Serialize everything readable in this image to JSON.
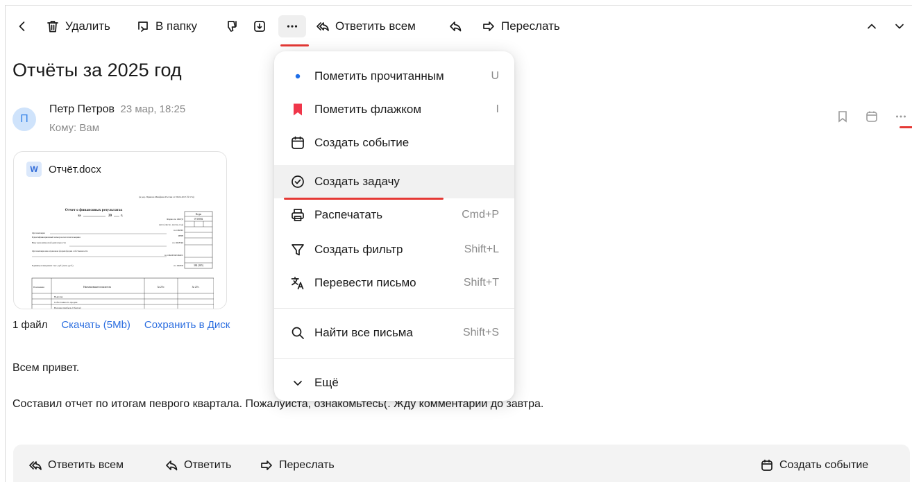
{
  "toolbar": {
    "delete_label": "Удалить",
    "folder_label": "В папку",
    "reply_all_label": "Ответить всем",
    "forward_label": "Переслать"
  },
  "message": {
    "subject": "Отчёты за 2025 год",
    "sender_initial": "П",
    "sender_name": "Петр Петров",
    "date": "23 мар, 18:25",
    "to": "Кому: Вам",
    "body_line1": "Всем привет.",
    "body_line2": "Составил  отчет по итогам певрого квартала. Пожалуйста, ознакомьтесь(. Жду комментарии до завтра."
  },
  "attachment": {
    "badge": "W",
    "filename": "Отчёт.docx",
    "count": "1 файл",
    "download": "Скачать (5Mb)",
    "save_disk": "Сохранить в Диск",
    "preview_title": "Отчет о финансовых результатах",
    "preview_za": "за",
    "preview_year": "20",
    "preview_g": "г.",
    "preview_codes": "Коды",
    "preview_okud": "0710002",
    "preview_code_last": "384 (385)",
    "preview_approval": "(в ред. Приказа Минфина России от 06.04.2015 № 57н)",
    "preview_rows": [
      "Форма по ОКУД",
      "Дата (число, месяц, год)",
      "по ОКПО",
      "ИНН",
      "по ОКВЭД",
      "по ОКОПФ/ОКФС",
      "по ОКЕИ"
    ],
    "preview_left": [
      "Организация",
      "Идентификационный номер налогоплательщика",
      "Вид экономической деятельности",
      "Организационно-правовая форма/форма собственности",
      "Единица измерения: тыс. руб. (млн. руб.)"
    ],
    "preview_table_head": [
      "Пояснения",
      "Наименование показателя",
      "За 20 г.",
      "За 20 г."
    ],
    "preview_table_rows": [
      "Выручка",
      "Себестоимость продаж",
      "Валовая прибыль (убыток)"
    ]
  },
  "menu": {
    "items": [
      {
        "label": "Пометить прочитанным",
        "shortcut": "U"
      },
      {
        "label": "Пометить флажком",
        "shortcut": "I"
      },
      {
        "label": "Создать событие",
        "shortcut": ""
      },
      {
        "label": "Создать задачу",
        "shortcut": ""
      },
      {
        "label": "Распечатать",
        "shortcut": "Cmd+P"
      },
      {
        "label": "Создать фильтр",
        "shortcut": "Shift+L"
      },
      {
        "label": "Перевести письмо",
        "shortcut": "Shift+T"
      },
      {
        "label": "Найти все письма",
        "shortcut": "Shift+S"
      },
      {
        "label": "Ещё",
        "shortcut": ""
      }
    ]
  },
  "bottom": {
    "reply_all": "Ответить всем",
    "reply": "Ответить",
    "forward": "Переслать",
    "create_event": "Создать событие"
  },
  "colors": {
    "accent_red": "#e53935",
    "link_blue": "#2d6fe0",
    "unread_dot": "#1e6ee8",
    "flag_red": "#f0364a"
  }
}
